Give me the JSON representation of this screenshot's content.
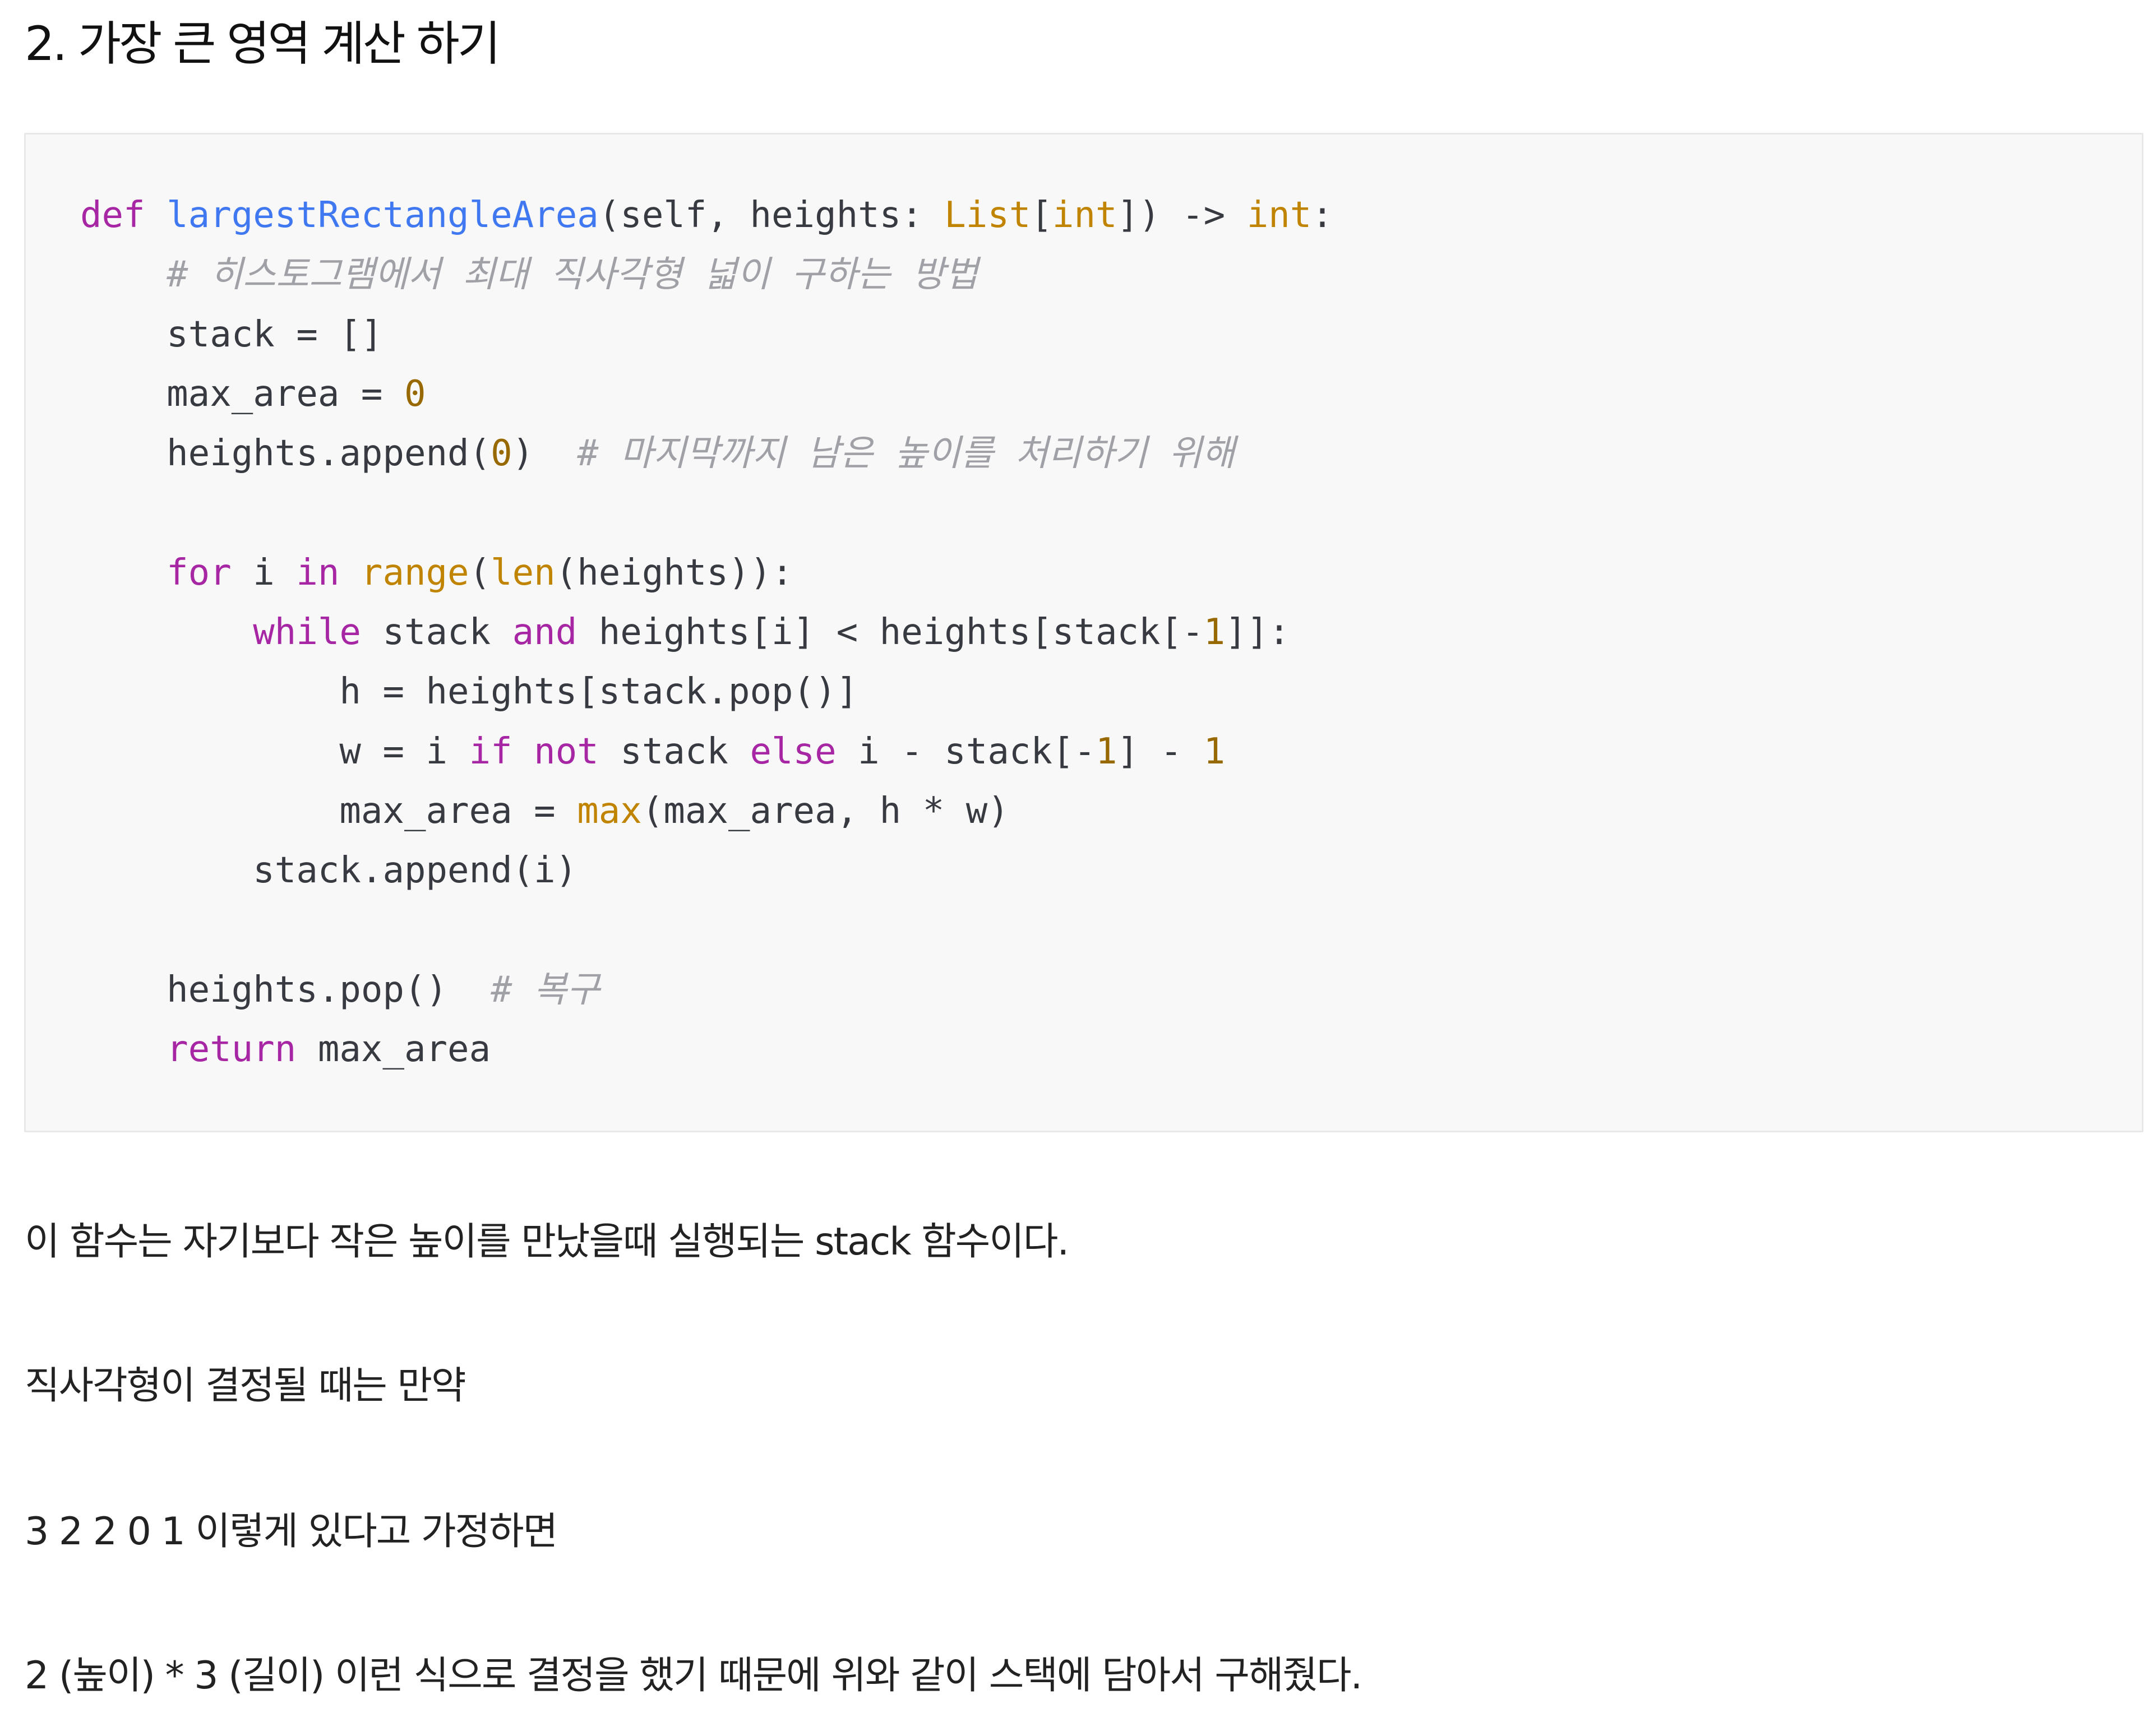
{
  "heading": "2. 가장 큰 영역 계산 하기",
  "code_colors": {
    "keyword": "#a626a4",
    "function_name": "#4078f2",
    "builtin": "#c18401",
    "number": "#986801",
    "comment": "#a0a1a7",
    "plain": "#383a42",
    "background": "#f8f8f8"
  },
  "code": {
    "language": "python",
    "lines": [
      [
        {
          "t": "kw",
          "v": "def"
        },
        {
          "t": "pl",
          "v": " "
        },
        {
          "t": "fn",
          "v": "largestRectangleArea"
        },
        {
          "t": "pl",
          "v": "(self, heights: "
        },
        {
          "t": "bi",
          "v": "List"
        },
        {
          "t": "pl",
          "v": "["
        },
        {
          "t": "bi",
          "v": "int"
        },
        {
          "t": "pl",
          "v": "]) -> "
        },
        {
          "t": "bi",
          "v": "int"
        },
        {
          "t": "pl",
          "v": ":"
        }
      ],
      [
        {
          "t": "pl",
          "v": "    "
        },
        {
          "t": "cm",
          "v": "# 히스토그램에서 최대 직사각형 넓이 구하는 방법"
        }
      ],
      [
        {
          "t": "pl",
          "v": "    stack = []"
        }
      ],
      [
        {
          "t": "pl",
          "v": "    max_area = "
        },
        {
          "t": "num",
          "v": "0"
        }
      ],
      [
        {
          "t": "pl",
          "v": "    heights.append("
        },
        {
          "t": "num",
          "v": "0"
        },
        {
          "t": "pl",
          "v": ")  "
        },
        {
          "t": "cm",
          "v": "# 마지막까지 남은 높이를 처리하기 위해"
        }
      ],
      [],
      [
        {
          "t": "pl",
          "v": "    "
        },
        {
          "t": "kw",
          "v": "for"
        },
        {
          "t": "pl",
          "v": " i "
        },
        {
          "t": "kw",
          "v": "in"
        },
        {
          "t": "pl",
          "v": " "
        },
        {
          "t": "bi",
          "v": "range"
        },
        {
          "t": "pl",
          "v": "("
        },
        {
          "t": "bi",
          "v": "len"
        },
        {
          "t": "pl",
          "v": "(heights)):"
        }
      ],
      [
        {
          "t": "pl",
          "v": "        "
        },
        {
          "t": "kw",
          "v": "while"
        },
        {
          "t": "pl",
          "v": " stack "
        },
        {
          "t": "kw",
          "v": "and"
        },
        {
          "t": "pl",
          "v": " heights[i] < heights[stack[-"
        },
        {
          "t": "num",
          "v": "1"
        },
        {
          "t": "pl",
          "v": "]]:"
        }
      ],
      [
        {
          "t": "pl",
          "v": "            h = heights[stack.pop()]"
        }
      ],
      [
        {
          "t": "pl",
          "v": "            w = i "
        },
        {
          "t": "kw",
          "v": "if"
        },
        {
          "t": "pl",
          "v": " "
        },
        {
          "t": "kw",
          "v": "not"
        },
        {
          "t": "pl",
          "v": " stack "
        },
        {
          "t": "kw",
          "v": "else"
        },
        {
          "t": "pl",
          "v": " i - stack[-"
        },
        {
          "t": "num",
          "v": "1"
        },
        {
          "t": "pl",
          "v": "] - "
        },
        {
          "t": "num",
          "v": "1"
        }
      ],
      [
        {
          "t": "pl",
          "v": "            max_area = "
        },
        {
          "t": "bi",
          "v": "max"
        },
        {
          "t": "pl",
          "v": "(max_area, h * w)"
        }
      ],
      [
        {
          "t": "pl",
          "v": "        stack.append(i)"
        }
      ],
      [],
      [
        {
          "t": "pl",
          "v": "    heights.pop()  "
        },
        {
          "t": "cm",
          "v": "# 복구"
        }
      ],
      [
        {
          "t": "pl",
          "v": "    "
        },
        {
          "t": "kw",
          "v": "return"
        },
        {
          "t": "pl",
          "v": " max_area"
        }
      ]
    ]
  },
  "paragraphs": [
    "이 함수는 자기보다 작은 높이를 만났을때 실행되는 stack 함수이다.",
    "직사각형이 결정될 때는 만약",
    "3  2  2  0  1 이렇게 있다고 가정하면",
    "2 (높이) * 3 (길이) 이런 식으로 결정을 했기 때문에 위와 같이 스택에 담아서 구해줬다."
  ]
}
